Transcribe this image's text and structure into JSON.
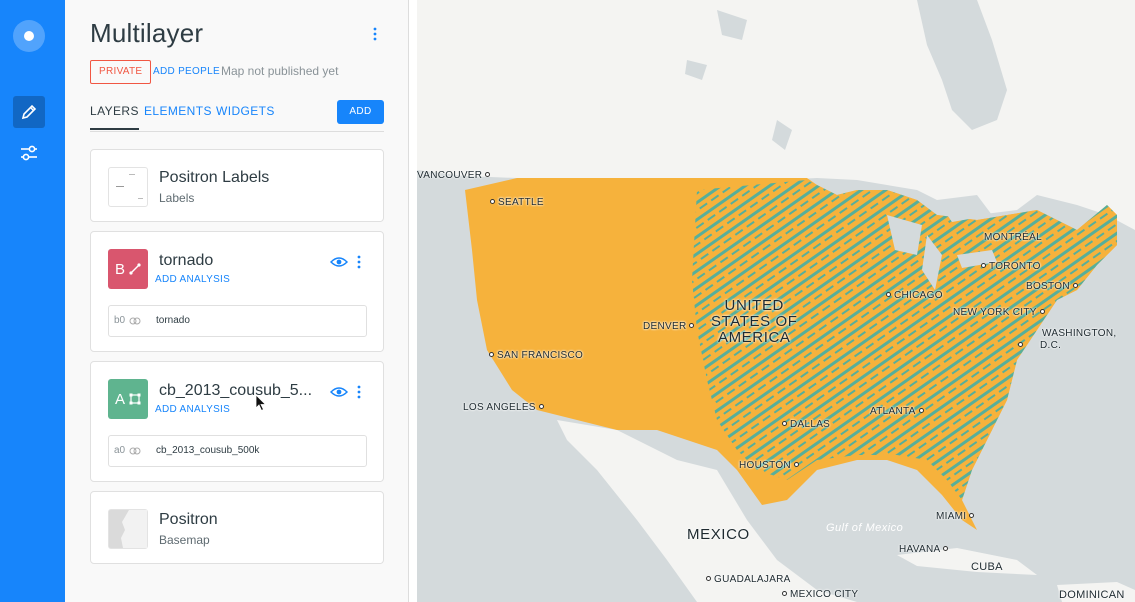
{
  "rail": {
    "logo_icon": "carto-logo-icon",
    "items": [
      {
        "icon": "pencil-icon",
        "active": true
      },
      {
        "icon": "sliders-icon",
        "active": false
      }
    ],
    "accent_color": "#1785fb"
  },
  "header": {
    "title": "Multilayer",
    "privacy_badge": "PRIVATE",
    "add_people": "ADD PEOPLE",
    "publish_status": "Map not published yet"
  },
  "tabs": [
    {
      "label": "LAYERS",
      "active": true
    },
    {
      "label": "ELEMENTS",
      "active": false
    },
    {
      "label": "WIDGETS",
      "active": false
    }
  ],
  "add_button": "ADD",
  "layers": [
    {
      "name": "Positron Labels",
      "subtitle": "Labels",
      "kind": "basemap-labels"
    },
    {
      "letter": "B",
      "name": "tornado",
      "add_analysis": "ADD ANALYSIS",
      "source_id": "b0",
      "source_name": "tornado",
      "color": "#d9566e",
      "geom_icon": "line-geometry-icon"
    },
    {
      "letter": "A",
      "name": "cb_2013_cousub_5...",
      "add_analysis": "ADD ANALYSIS",
      "source_id": "a0",
      "source_name": "cb_2013_cousub_500k",
      "color": "#5fb48f",
      "geom_icon": "polygon-geometry-icon"
    },
    {
      "name": "Positron",
      "subtitle": "Basemap",
      "kind": "basemap"
    }
  ],
  "map": {
    "countries": [
      "UNITED STATES OF AMERICA",
      "MEXICO"
    ],
    "us_label_lines": [
      "UNITED",
      "STATES OF",
      "AMERICA"
    ],
    "sea": "Gulf of Mexico",
    "cities": [
      "VANCOUVER",
      "SEATTLE",
      "MONTRÉAL",
      "TORONTO",
      "BOSTON",
      "CHICAGO",
      "NEW YORK CITY",
      "WASHINGTON,",
      "D.C.",
      "DENVER",
      "SAN FRANCISCO",
      "LOS ANGELES",
      "ATLANTA",
      "DALLAS",
      "HOUSTON",
      "MIAMI",
      "HAVANA",
      "CUBA",
      "GUADALAJARA",
      "MEXICO CITY",
      "DOMINICAN"
    ],
    "colors": {
      "polygons": "#f6b23c",
      "tornado": "#4faf9f",
      "land": "#f4f4f2",
      "water": "#d4dadc"
    }
  }
}
